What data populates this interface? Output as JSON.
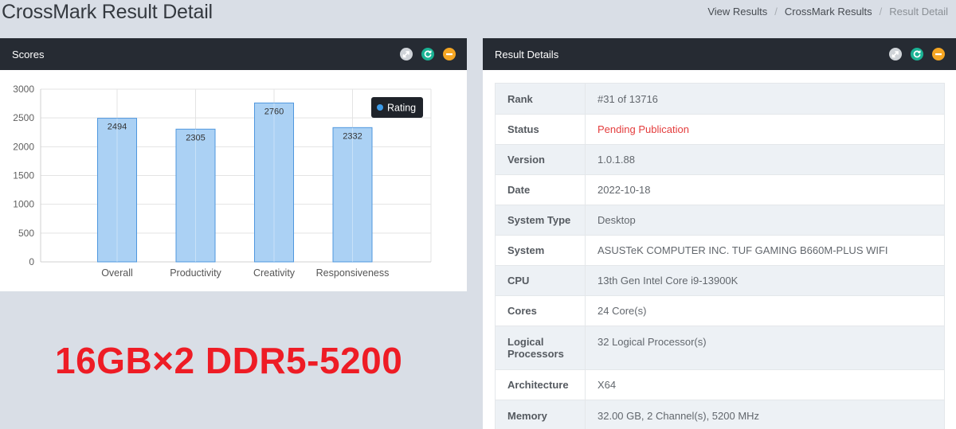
{
  "page": {
    "title": "CrossMark Result Detail"
  },
  "breadcrumb": {
    "items": [
      "View Results",
      "CrossMark Results"
    ],
    "separator": "/",
    "current": "Result Detail"
  },
  "colors": {
    "bar_fill": "#abd1f4",
    "bar_stroke": "#4f97de",
    "legend_dot": "#3c9be8",
    "header_bg": "#262b33",
    "status_red": "#e43d3d",
    "overlay_red": "#ee1c25",
    "tool_green": "#1ab394",
    "tool_orange": "#f5a623"
  },
  "scores_panel": {
    "title": "Scores",
    "tools": [
      "expand-icon",
      "refresh-icon",
      "collapse-icon"
    ]
  },
  "chart_data": {
    "type": "bar",
    "categories": [
      "Overall",
      "Productivity",
      "Creativity",
      "Responsiveness"
    ],
    "series": [
      {
        "name": "Rating",
        "values": [
          2494,
          2305,
          2760,
          2332
        ]
      }
    ],
    "ylim": [
      0,
      3000
    ],
    "yticks": [
      0,
      500,
      1000,
      1500,
      2000,
      2500,
      3000
    ],
    "data_labels": [
      "2494",
      "2305",
      "2760",
      "2332"
    ],
    "legend": {
      "position": "top-right"
    },
    "grid": true,
    "title": "",
    "xlabel": "",
    "ylabel": ""
  },
  "details_panel": {
    "title": "Result Details",
    "tools": [
      "expand-icon",
      "refresh-icon",
      "collapse-icon"
    ],
    "rows": [
      {
        "key": "Rank",
        "value": "#31 of 13716"
      },
      {
        "key": "Status",
        "value": "Pending Publication"
      },
      {
        "key": "Version",
        "value": "1.0.1.88"
      },
      {
        "key": "Date",
        "value": "2022-10-18"
      },
      {
        "key": "System Type",
        "value": "Desktop"
      },
      {
        "key": "System",
        "value": "ASUSTeK COMPUTER INC. TUF GAMING B660M-PLUS WIFI"
      },
      {
        "key": "CPU",
        "value": "13th Gen Intel Core i9-13900K"
      },
      {
        "key": "Cores",
        "value": "24 Core(s)"
      },
      {
        "key": "Logical Processors",
        "value": "32 Logical Processor(s)"
      },
      {
        "key": "Architecture",
        "value": "X64"
      },
      {
        "key": "Memory",
        "value": "32.00 GB, 2 Channel(s), 5200 MHz"
      }
    ]
  },
  "overlay": {
    "text": "16GB×2 DDR5-5200"
  }
}
